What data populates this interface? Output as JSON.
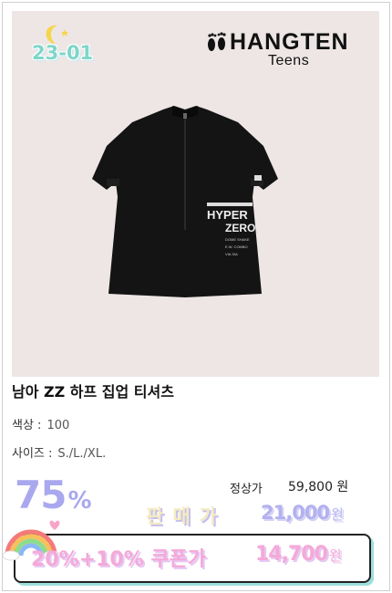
{
  "badge": {
    "label": "23-01"
  },
  "brand": {
    "name": "HANGTEN",
    "sub": "Teens"
  },
  "shirt_print": {
    "line1": "HYPER",
    "line2": "ZERO",
    "small1": "DOME SHAKE",
    "small2": "E.W. COMBO",
    "small3": "VIA SIA"
  },
  "product": {
    "title": "남아 ZZ  하프 집업 티셔츠",
    "color_label": "색상 :",
    "color_value": "100",
    "size_label": "사이즈 :",
    "size_value": "S./L./XL."
  },
  "pricing": {
    "discount_number": "75",
    "discount_sign": "%",
    "original_label": "정상가",
    "original_price": "59,800 원",
    "sale_label": "판매가",
    "sale_price": "21,000",
    "sale_unit": "원",
    "coupon_label": "20%+10% 쿠폰가",
    "coupon_price": "14,700",
    "coupon_unit": "원"
  },
  "icons": [
    "moon-icon",
    "star-icon",
    "footprint-logo-icon",
    "rainbow-icon",
    "zipper-icon"
  ],
  "colors": {
    "accent_lavender": "#a9a8ee",
    "coupon_pink": "#f4a9d8",
    "mint": "#7fd6c8",
    "photo_bg": "#ede6e5"
  }
}
